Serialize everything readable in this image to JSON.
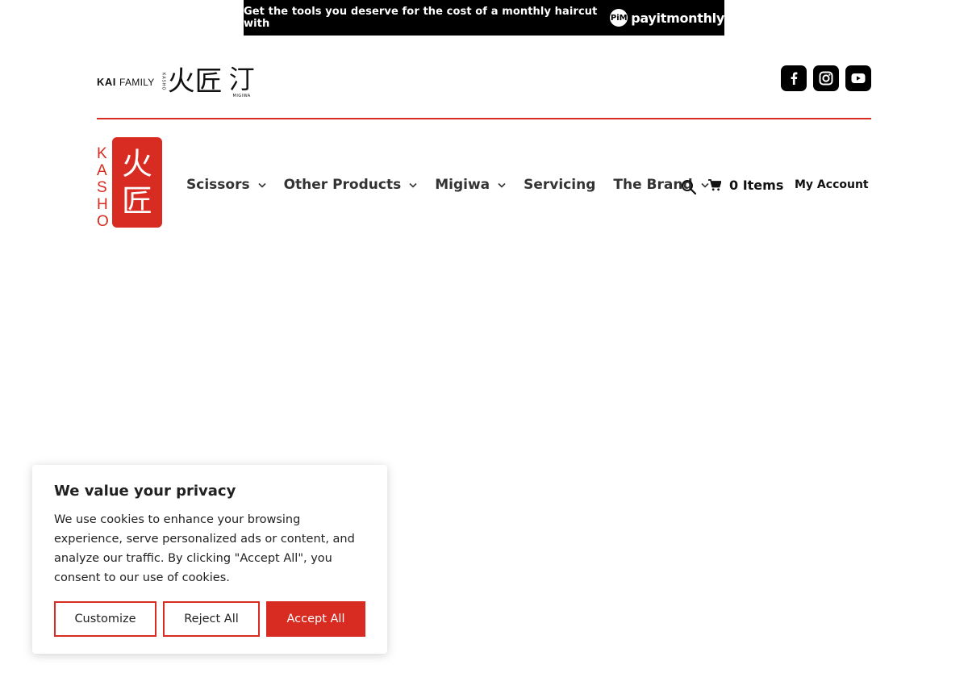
{
  "promo": {
    "text": "Get the tools you deserve for the cost of a monthly haircut with",
    "brand": "payitmonthly",
    "badge": "PiM"
  },
  "family_logo": {
    "kai": "KAI",
    "family": "FAMILY",
    "kasho_vertical": "KASHO",
    "kasho_kanji": "火匠",
    "migiwa_kanji": "汀",
    "migiwa_sub": "MIGIWA"
  },
  "social": {
    "icons": [
      "facebook-icon",
      "instagram-icon",
      "youtube-icon"
    ]
  },
  "main_logo": {
    "letters": [
      "K",
      "A",
      "S",
      "H",
      "O"
    ],
    "kanji_top": "火",
    "kanji_bottom": "匠"
  },
  "nav": {
    "items": [
      {
        "label": "Scissors",
        "has_dropdown": true
      },
      {
        "label": "Other Products",
        "has_dropdown": true
      },
      {
        "label": "Migiwa",
        "has_dropdown": true
      },
      {
        "label": "Servicing",
        "has_dropdown": false
      },
      {
        "label": "The Brand",
        "has_dropdown": true
      }
    ],
    "cart_label": "0 Items",
    "account_label": "My Account"
  },
  "cookie": {
    "title": "We value your privacy",
    "body": "We use cookies to enhance your browsing experience, serve personalized ads or content, and analyze our traffic. By clicking \"Accept All\", you consent to our use of cookies.",
    "customize": "Customize",
    "reject": "Reject All",
    "accept": "Accept All"
  },
  "colors": {
    "brand_red": "#d82b21",
    "black": "#000000",
    "text": "#333333"
  }
}
